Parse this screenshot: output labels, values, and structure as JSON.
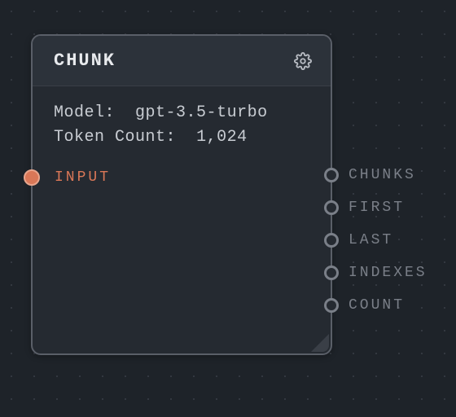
{
  "node": {
    "title": "CHUNK",
    "model_label": "Model:",
    "model_value": "gpt-3.5-turbo",
    "token_label": "Token Count:",
    "token_value": "1,024",
    "input_port_label": "INPUT",
    "output_ports": {
      "0": {
        "label": "CHUNKS"
      },
      "1": {
        "label": "FIRST"
      },
      "2": {
        "label": "LAST"
      },
      "3": {
        "label": "INDEXES"
      },
      "4": {
        "label": "COUNT"
      }
    }
  }
}
